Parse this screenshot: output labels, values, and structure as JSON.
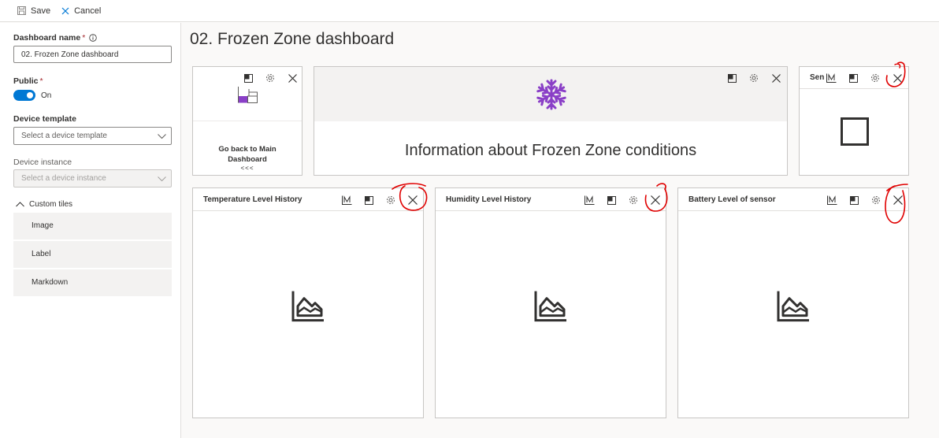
{
  "toolbar": {
    "save_label": "Save",
    "cancel_label": "Cancel"
  },
  "form": {
    "dashboard_name_label": "Dashboard name",
    "required_mark": "*",
    "dashboard_name_value": "02. Frozen Zone dashboard",
    "public_label": "Public",
    "public_toggle_state": "On",
    "device_template_label": "Device template",
    "device_template_placeholder": "Select a device template",
    "device_instance_label": "Device instance",
    "device_instance_placeholder": "Select a device instance"
  },
  "custom_tiles": {
    "header": "Custom tiles",
    "items": [
      "Image",
      "Label",
      "Markdown"
    ]
  },
  "page": {
    "title": "02. Frozen Zone dashboard"
  },
  "tiles": {
    "link_tile": {
      "text": "Go back to Main Dashboard",
      "arrows": "<<<"
    },
    "label_tile": {
      "text": "Information about Frozen Zone conditions"
    },
    "sensor_tile": {
      "title": "Sen"
    },
    "charts": [
      {
        "title": "Temperature Level History"
      },
      {
        "title": "Humidity Level History"
      },
      {
        "title": "Battery Level of sensor"
      }
    ]
  },
  "colors": {
    "accent": "#0078d4",
    "snowflake": "#8a3fc7",
    "annotation": "#e00000"
  }
}
